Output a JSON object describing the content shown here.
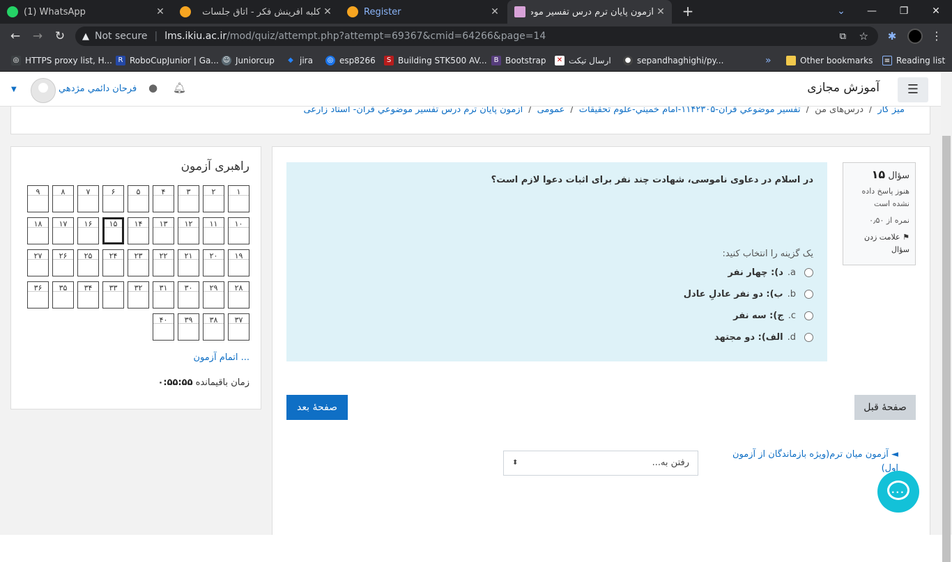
{
  "browser": {
    "tabs": [
      {
        "title": "(1) WhatsApp",
        "icon": "whatsapp-icon",
        "color": "#25d366"
      },
      {
        "title": "کلبه آفرینش فکر - اتاق جلسات",
        "icon": "moodle-icon",
        "color": "#f7a521"
      },
      {
        "title": "Register",
        "icon": "moodle-icon",
        "color": "#f7a521"
      },
      {
        "title": "آزمون پایان ترم درس تفسیر موضوعی",
        "icon": "ikiu-icon",
        "color": "#d8a2d8"
      }
    ],
    "url_warning": "Not secure",
    "url_host": "lms.ikiu.ac.ir",
    "url_path": "/mod/quiz/attempt.php?attempt=69367&cmid=64266&page=14",
    "bookmarks": [
      {
        "label": "HTTPS proxy list, H...",
        "icon": "globe-icon"
      },
      {
        "label": "RoboCupJunior | Ga...",
        "icon": "robocup-icon"
      },
      {
        "label": "Juniorcup",
        "icon": "discord-icon"
      },
      {
        "label": "jira",
        "icon": "jira-icon"
      },
      {
        "label": "esp8266",
        "icon": "globe-icon"
      },
      {
        "label": "Building STK500 AV...",
        "icon": "sp-icon"
      },
      {
        "label": "Bootstrap",
        "icon": "bootstrap-icon"
      },
      {
        "label": "ارسال تیکت",
        "icon": "ticket-icon"
      },
      {
        "label": "sepandhaghighi/py...",
        "icon": "github-icon"
      }
    ],
    "bookmarks_overflow": "»",
    "other_bookmarks": "Other bookmarks",
    "reading_list": "Reading list"
  },
  "site": {
    "name": "آموزش مجازی",
    "user_name": "فرحان دائمي مژدهي"
  },
  "breadcrumb": [
    "میز کار",
    "درس‌های من",
    "تفسير موضوعي قرآن-۱۱۴۲۳۰۵-امام خميني-علوم تحقيقات",
    "عمومی",
    "آزمون پایان ترم درس تفسير موضوعي قرآن- استاد زارعی"
  ],
  "question": {
    "label": "سؤال",
    "number": "۱۵",
    "state": "هنوز پاسخ داده نشده است",
    "marks": "نمره از ۰٫۵۰",
    "flag_label": "علامت زدن سؤال",
    "text": "در اسلام در دعاوی ناموسی، شهادت چند نفر برای اثبات دعوا لازم است؟",
    "prompt": "یک گزینه را انتخاب کنید:",
    "options": [
      {
        "letter": "a.",
        "text": "د): چهار نفر"
      },
      {
        "letter": "b.",
        "text": "ب): دو نفر عادلِ عادل"
      },
      {
        "letter": "c.",
        "text": "ج): سه نفر"
      },
      {
        "letter": "d.",
        "text": "الف): دو مجتهد"
      }
    ]
  },
  "buttons": {
    "previous": "صفحهٔ قبل",
    "next": "صفحهٔ بعد"
  },
  "activity_nav": {
    "prev_link": "آزمون میان ترم(ویژه بازماندگان از آزمون اول)",
    "jump_placeholder": "رفتن به..."
  },
  "quiz_nav": {
    "title": "راهبری آزمون",
    "questions": [
      "۱",
      "۲",
      "۳",
      "۴",
      "۵",
      "۶",
      "۷",
      "۸",
      "۹",
      "۱۰",
      "۱۱",
      "۱۲",
      "۱۳",
      "۱۴",
      "۱۵",
      "۱۶",
      "۱۷",
      "۱۸",
      "۱۹",
      "۲۰",
      "۲۱",
      "۲۲",
      "۲۳",
      "۲۴",
      "۲۵",
      "۲۶",
      "۲۷",
      "۲۸",
      "۲۹",
      "۳۰",
      "۳۱",
      "۳۲",
      "۳۳",
      "۳۴",
      "۳۵",
      "۳۶",
      "۳۷",
      "۳۸",
      "۳۹",
      "۴۰"
    ],
    "current": "۱۵",
    "finish_link": "اتمام آزمون ...",
    "time_label": "زمان باقیمانده",
    "time_value": "۰:۵۵:۵۵"
  },
  "colors": {
    "link": "#0f6fc5",
    "question_bg": "#def2f8",
    "chat_fab": "#13c1d8"
  }
}
